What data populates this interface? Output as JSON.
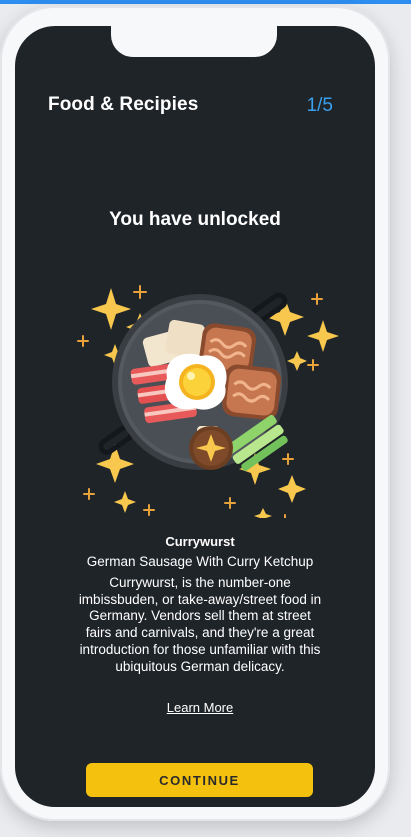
{
  "header": {
    "title": "Food & Recipies",
    "page_counter": "1/5"
  },
  "unlock": {
    "heading": "You have unlocked"
  },
  "item": {
    "name": "Currywurst",
    "subtitle": "German Sausage With Curry Ketchup",
    "description": "Currywurst, is the number-one imbissbuden, or take-away/street food in Germany. Vendors sell them at street fairs and carnivals, and they're a great introduction for those unfamiliar with this ubiquitous German delicacy.",
    "learn_more_label": "Learn More",
    "illustration_icon": "pan-of-food-with-sparkles-icon"
  },
  "actions": {
    "continue_label": "CONTINUE"
  },
  "colors": {
    "screen_background": "#1f2429",
    "accent_blue": "#3aa0f0",
    "button_yellow": "#f5c10f",
    "sparkle_yellow": "#f8c74d"
  }
}
